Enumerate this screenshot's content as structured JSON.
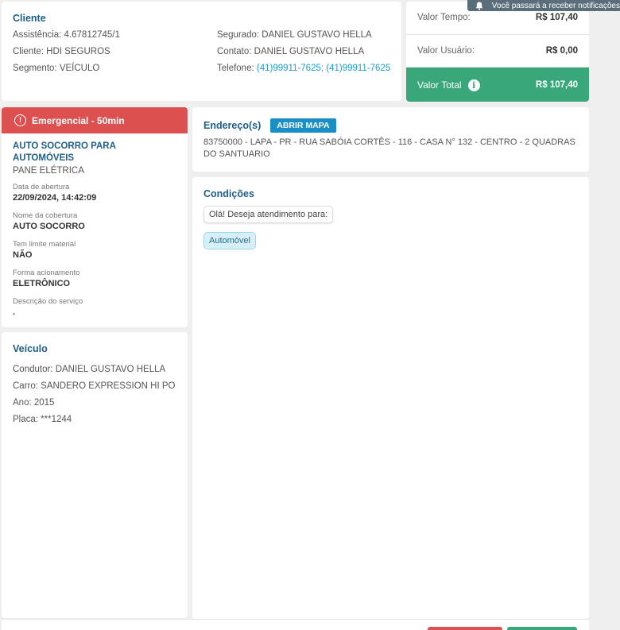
{
  "cliente": {
    "title": "Cliente",
    "assistencia": "Assistência: 4.67812745/1",
    "cliente": "Cliente: HDI SEGUROS",
    "segmento": "Segmento: VEÍCULO",
    "segurado": "Segurado: DANIEL GUSTAVO HELLA",
    "contato": "Contato: DANIEL GUSTAVO HELLA",
    "telefone_label": "Telefone: ",
    "telefone_value": "(41)99911-7625; (41)99911-7625"
  },
  "valores": {
    "tempo_label": "Valor Tempo:",
    "tempo_value": "R$ 107,40",
    "usuario_label": "Valor Usuário:",
    "usuario_value": "R$ 0,00",
    "total_label": "Valor Total",
    "total_value": "R$ 107,40"
  },
  "notification": {
    "text": "Você passará a receber notificações"
  },
  "servico": {
    "header": "Emergencial - 50min",
    "title": "AUTO SOCORRO PARA AUTOMÓVEIS",
    "subtitle": "PANE ELÉTRICA",
    "fields": [
      {
        "label": "Data de abertura",
        "value": "22/09/2024, 14:42:09"
      },
      {
        "label": "Nome da cobertura",
        "value": "AUTO SOCORRO"
      },
      {
        "label": "Tem limite material",
        "value": "NÃO"
      },
      {
        "label": "Forma acionamento",
        "value": "ELETRÔNICO"
      },
      {
        "label": "Descrição do serviço",
        "value": "."
      }
    ]
  },
  "veiculo": {
    "title": "Veículo",
    "condutor": "Condutor: DANIEL GUSTAVO HELLA",
    "carro": "Carro: SANDERO EXPRESSION HI PO",
    "ano": "Ano: 2015",
    "placa": "Placa: ***1244"
  },
  "endereco": {
    "title": "Endereço(s)",
    "button": "ABRIR MAPA",
    "text": "83750000 - LAPA - PR - RUA SABÓIA CORTÊS - 116 - CASA N° 132 - CENTRO - 2 QUADRAS DO SANTUARIO"
  },
  "condicoes": {
    "title": "Condições",
    "message": "Olá! Deseja atendimento para:",
    "option": "Automóvel"
  },
  "colors": {
    "accent_red": "#dc5050",
    "accent_green": "#3aa77a",
    "link_blue": "#1a9fc9",
    "title_blue": "#1f5f86"
  }
}
